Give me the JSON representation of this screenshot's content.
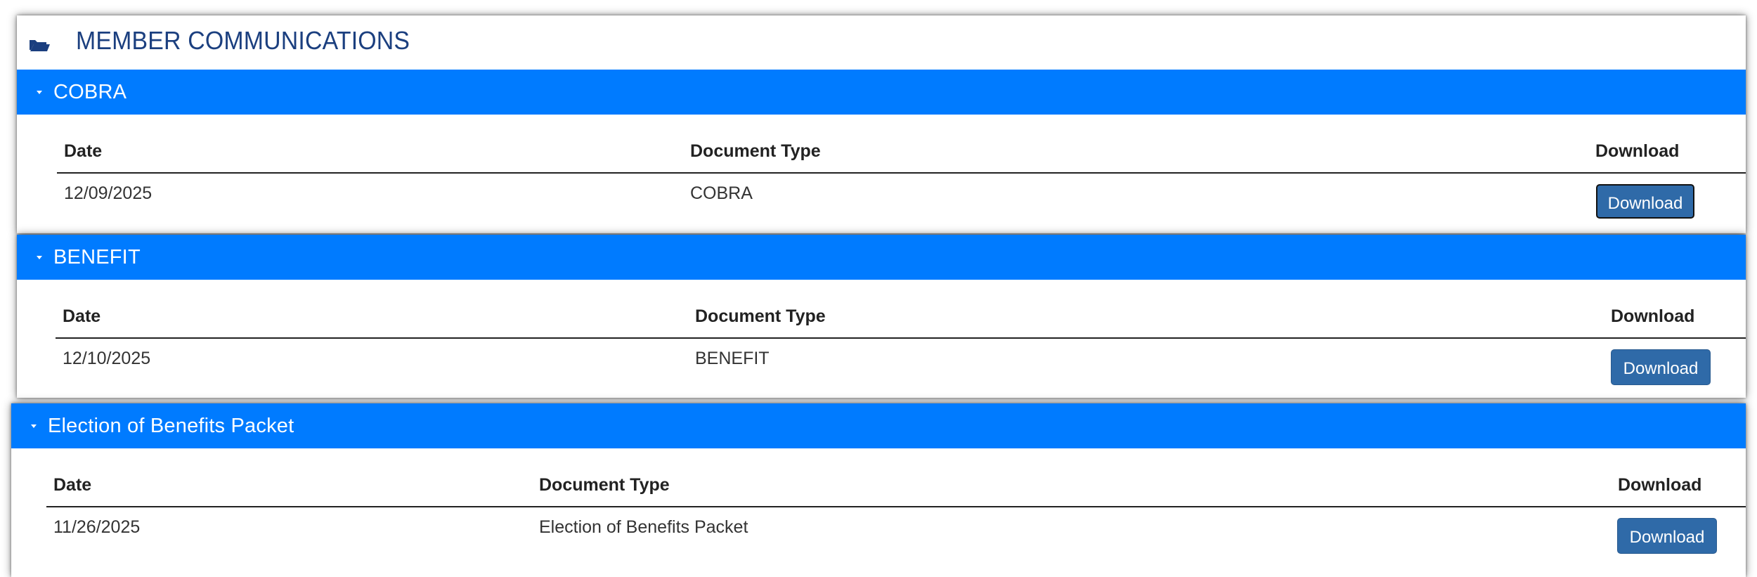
{
  "page": {
    "title": "MEMBER COMMUNICATIONS",
    "icon": "folder-open-icon",
    "accent": "#007bff",
    "title_color": "#1b3f7f",
    "button_color": "#2f6aa8"
  },
  "sections": [
    {
      "title": "COBRA",
      "headers": [
        "Date",
        "Document Type",
        "Download"
      ],
      "rows": [
        {
          "date": "12/09/2025",
          "document_type": "COBRA",
          "action": "Download"
        }
      ]
    },
    {
      "title": "BENEFIT",
      "headers": [
        "Date",
        "Document Type",
        "Download"
      ],
      "rows": [
        {
          "date": "12/10/2025",
          "document_type": "BENEFIT",
          "action": "Download"
        }
      ]
    },
    {
      "title": "Election of Benefits Packet",
      "headers": [
        "Date",
        "Document Type",
        "Download"
      ],
      "rows": [
        {
          "date": "11/26/2025",
          "document_type": "Election of Benefits Packet",
          "action": "Download"
        }
      ]
    }
  ]
}
